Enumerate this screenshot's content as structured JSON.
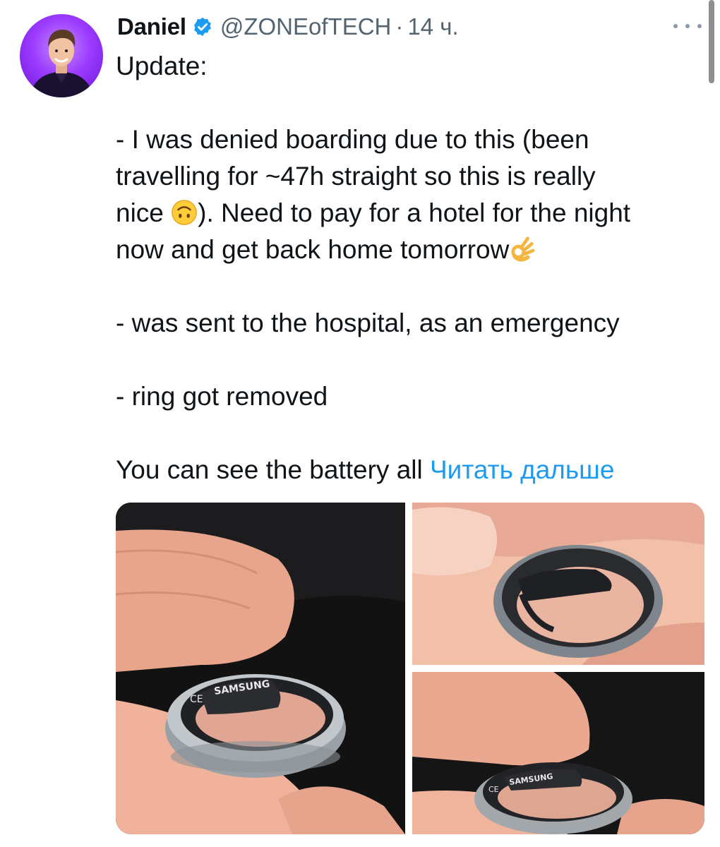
{
  "author": {
    "name": "Daniel",
    "handle": "@ZONEofTECH",
    "separator": "·",
    "time": "14 ч."
  },
  "tweet": {
    "line1": "Update:",
    "para1": [
      "- I was denied boarding due to this (been",
      "travelling for ~47h straight so this is really",
      "nice ",
      "). Need to pay for a hotel for the night",
      "now and get back home tomorrow"
    ],
    "para2": "- was sent to the hospital, as an emergency",
    "para3": "- ring got removed",
    "para4": "You can see the battery all ",
    "read_more": "Читать дальше"
  },
  "emojis": [
    "upside-down-face-emoji",
    "ok-hand-emoji"
  ],
  "media": {
    "ring_brand_text": "SAMSUNG",
    "ring_ce_mark": "CE"
  },
  "icons": [
    "verified-badge-icon",
    "more-options-icon"
  ],
  "colors": {
    "link": "#1d9bf0",
    "verified": "#1d9bf0",
    "secondary_text": "#536471"
  }
}
